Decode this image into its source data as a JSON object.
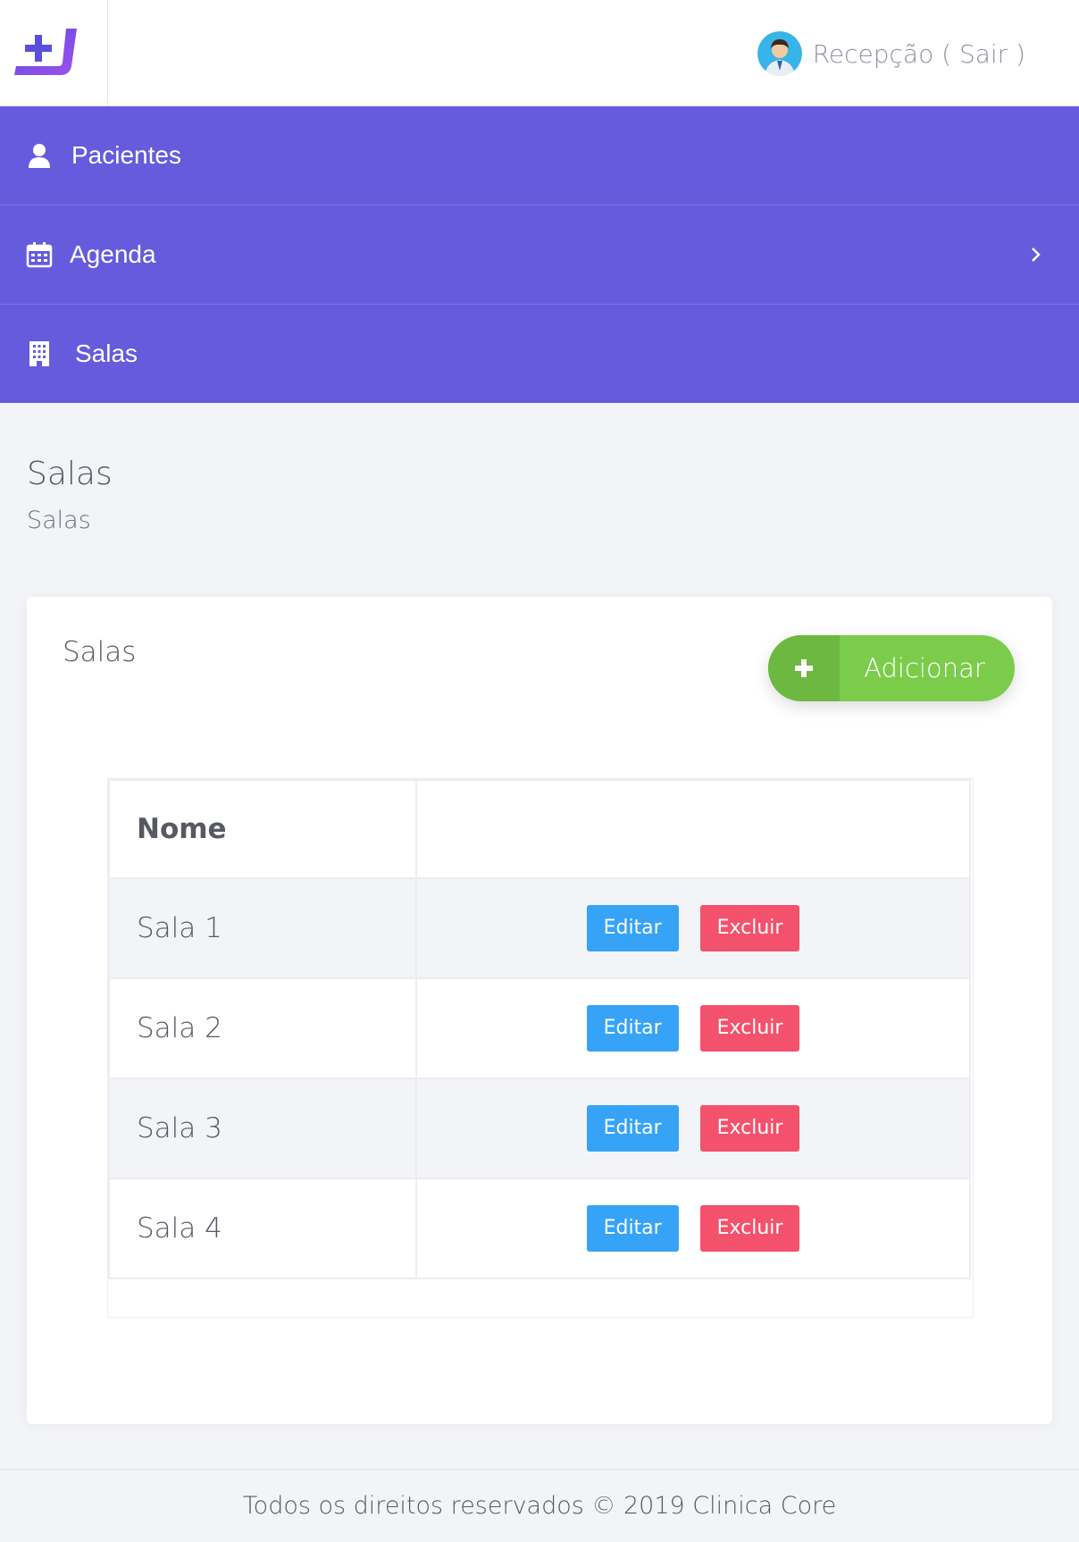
{
  "header": {
    "user_label": "Recepção ( Sair )"
  },
  "menu": {
    "items": [
      {
        "label": "Pacientes",
        "icon": "user-icon"
      },
      {
        "label": "Agenda",
        "icon": "calendar-icon",
        "has_submenu": true
      },
      {
        "label": "Salas",
        "icon": "building-icon"
      }
    ]
  },
  "page": {
    "title": "Salas",
    "subtitle": "Salas"
  },
  "card": {
    "title": "Salas",
    "add_button_label": "Adicionar",
    "table": {
      "headers": [
        "Nome",
        ""
      ],
      "rows": [
        {
          "name": "Sala 1",
          "edit_label": "Editar",
          "delete_label": "Excluir"
        },
        {
          "name": "Sala 2",
          "edit_label": "Editar",
          "delete_label": "Excluir"
        },
        {
          "name": "Sala 3",
          "edit_label": "Editar",
          "delete_label": "Excluir"
        },
        {
          "name": "Sala 4",
          "edit_label": "Editar",
          "delete_label": "Excluir"
        }
      ]
    }
  },
  "footer": {
    "text": "Todos os direitos reservados © 2019 Clinica Core"
  },
  "colors": {
    "menu_bg": "#655bdc",
    "add_green": "#7ccc4c",
    "edit_blue": "#36a3f7",
    "delete_red": "#f4516c"
  }
}
